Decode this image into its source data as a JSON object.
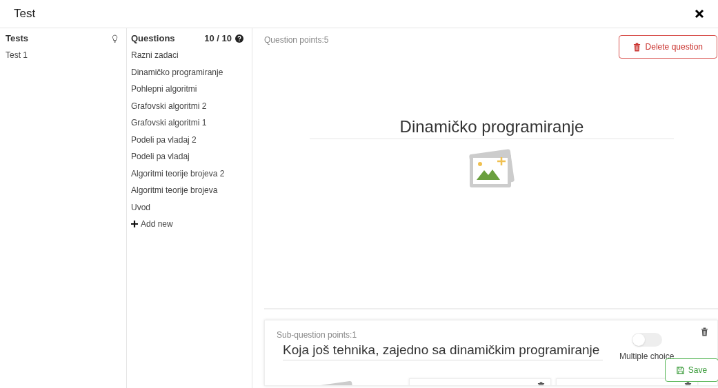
{
  "window": {
    "title": "Test"
  },
  "tests": {
    "heading": "Tests",
    "items": [
      {
        "label": "Test 1",
        "selected": false
      }
    ]
  },
  "questions": {
    "heading": "Questions",
    "count": "10 / 10",
    "items": [
      {
        "label": "Razni zadaci"
      },
      {
        "label": "Dinamičko programiranje"
      },
      {
        "label": "Pohlepni algoritmi"
      },
      {
        "label": "Grafovski algoritmi 2"
      },
      {
        "label": "Grafovski algoritmi 1"
      },
      {
        "label": "Podeli pa vladaj 2"
      },
      {
        "label": "Podeli pa vladaj"
      },
      {
        "label": "Algoritmi teorije brojeva 2"
      },
      {
        "label": "Algoritmi teorije brojeva"
      },
      {
        "label": "Uvod"
      }
    ],
    "add_label": "Add new"
  },
  "question": {
    "points": "Question points:5",
    "delete_label": "Delete question",
    "title": "Dinamičko programiranje"
  },
  "sub_question": {
    "points": "Sub-question points:1",
    "text": "Koja još tehnika, zajedno sa dinamičkim programiranje",
    "multiple_choice": {
      "label": "Multiple choice",
      "on": false
    }
  },
  "save_label": "Save"
}
